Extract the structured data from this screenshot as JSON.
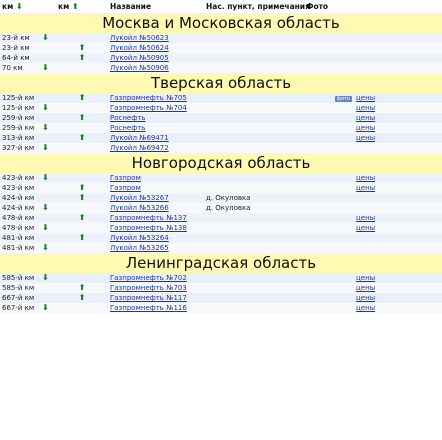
{
  "headers": {
    "km_left": "км",
    "km_left_arrow": "⬇",
    "km_right": "км",
    "km_right_arrow": "⬆",
    "name": "Название",
    "notes": "Нас. пункт, примечания",
    "photo": "Фото"
  },
  "regions": [
    {
      "title": "Москва и Московская область",
      "rows": [
        {
          "km": "23-й км",
          "down": "⬇",
          "up": "",
          "name": "Лукойл №50623",
          "note": "",
          "foto": "",
          "price": ""
        },
        {
          "km": "23-й км",
          "down": "",
          "up": "⬆",
          "name": "Лукойл №50624",
          "note": "",
          "foto": "",
          "price": ""
        },
        {
          "km": "64-й км",
          "down": "",
          "up": "⬆",
          "name": "Лукойл №50905",
          "note": "",
          "foto": "",
          "price": ""
        },
        {
          "km": "70 км",
          "down": "⬇",
          "up": "",
          "name": "Лукойл №50906",
          "note": "",
          "foto": "",
          "price": ""
        }
      ]
    },
    {
      "title": "Тверская область",
      "rows": [
        {
          "km": "125-й км",
          "down": "",
          "up": "⬆",
          "name": "Газпромнефть №705",
          "note": "",
          "foto": "фото",
          "price": "цены"
        },
        {
          "km": "125-й км",
          "down": "⬇",
          "up": "",
          "name": "Газпромнефть №704",
          "note": "",
          "foto": "",
          "price": "цены"
        },
        {
          "km": "259-й км",
          "down": "",
          "up": "⬆",
          "name": "Роснефть",
          "note": "",
          "foto": "",
          "price": "цены"
        },
        {
          "km": "259-й км",
          "down": "⬇",
          "up": "",
          "name": "Роснефть",
          "note": "",
          "foto": "",
          "price": "цены"
        },
        {
          "km": "313-й км",
          "down": "",
          "up": "⬆",
          "name": "Лукойл №69471",
          "note": "",
          "foto": "",
          "price": "цены"
        },
        {
          "km": "327-й км",
          "down": "⬇",
          "up": "",
          "name": "Лукойл №69472",
          "note": "",
          "foto": "",
          "price": ""
        }
      ]
    },
    {
      "title": "Новгородская область",
      "rows": [
        {
          "km": "423-й км",
          "down": "⬇",
          "up": "",
          "name": "Газпром",
          "note": "",
          "foto": "",
          "price": "цены"
        },
        {
          "km": "423-й км",
          "down": "",
          "up": "⬆",
          "name": "Газпром",
          "note": "",
          "foto": "",
          "price": "цены"
        },
        {
          "km": "424-й км",
          "down": "",
          "up": "⬆",
          "name": "Лукойл №53267",
          "note": "д. Окуловка",
          "foto": "",
          "price": ""
        },
        {
          "km": "424-й км",
          "down": "⬇",
          "up": "",
          "name": "Лукойл №53266",
          "note": "д. Окуловка",
          "foto": "",
          "price": ""
        },
        {
          "km": "478-й км",
          "down": "",
          "up": "⬆",
          "name": "Газпромнефть №137",
          "note": "",
          "foto": "",
          "price": "цены"
        },
        {
          "km": "478-й км",
          "down": "⬇",
          "up": "",
          "name": "Газпромнефть №138",
          "note": "",
          "foto": "",
          "price": "цены"
        },
        {
          "km": "481-й км",
          "down": "",
          "up": "⬆",
          "name": "Лукойл №53264",
          "note": "",
          "foto": "",
          "price": ""
        },
        {
          "km": "481-й км",
          "down": "⬇",
          "up": "",
          "name": "Лукойл №53265",
          "note": "",
          "foto": "",
          "price": ""
        }
      ]
    },
    {
      "title": "Ленинградская область",
      "rows": [
        {
          "km": "585-й км",
          "down": "⬇",
          "up": "",
          "name": "Газпромнефть №702",
          "note": "",
          "foto": "",
          "price": "цены"
        },
        {
          "km": "585-й км",
          "down": "",
          "up": "⬆",
          "name": "Газпромнефть №703",
          "note": "",
          "foto": "",
          "price": "цены"
        },
        {
          "km": "667-й км",
          "down": "",
          "up": "⬆",
          "name": "Газпромнефть №117",
          "note": "",
          "foto": "",
          "price": "цены"
        },
        {
          "km": "667-й км",
          "down": "⬇",
          "up": "",
          "name": "Газпромнефть №116",
          "note": "",
          "foto": "",
          "price": "цены"
        }
      ]
    }
  ],
  "colors": {
    "region_band": "#fff9b3",
    "arrow": "#1c7a22",
    "link": "#2233aa",
    "row_bg": "#eaf0f9"
  }
}
